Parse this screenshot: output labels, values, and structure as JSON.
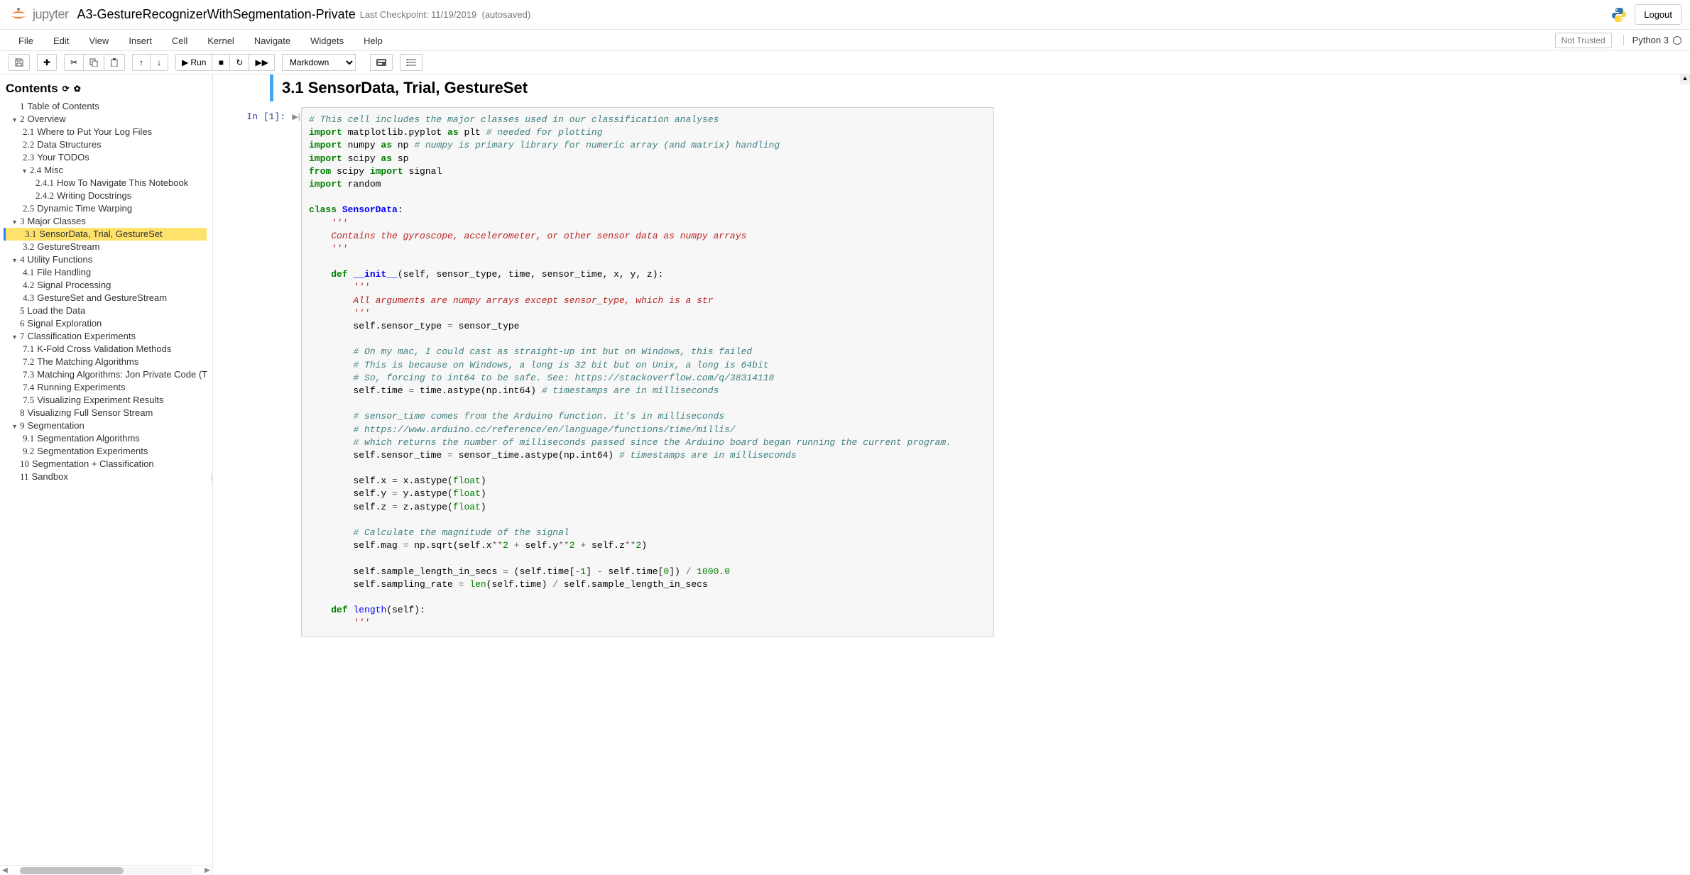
{
  "header": {
    "logo_text": "jupyter",
    "notebook_name": "A3-GestureRecognizerWithSegmentation-Private",
    "checkpoint": "Last Checkpoint: 11/19/2019",
    "autosaved": "(autosaved)",
    "logout": "Logout"
  },
  "menubar": {
    "items": [
      "File",
      "Edit",
      "View",
      "Insert",
      "Cell",
      "Kernel",
      "Navigate",
      "Widgets",
      "Help"
    ],
    "trust": "Not Trusted",
    "kernel": "Python 3"
  },
  "toolbar": {
    "run_label": "Run",
    "cell_type": "Markdown"
  },
  "toc": {
    "title": "Contents",
    "items": [
      {
        "level": 1,
        "num": "1",
        "label": "Table of Contents",
        "caret": ""
      },
      {
        "level": 1,
        "num": "2",
        "label": "Overview",
        "caret": "▾"
      },
      {
        "level": 2,
        "num": "2.1",
        "label": "Where to Put Your Log Files"
      },
      {
        "level": 2,
        "num": "2.2",
        "label": "Data Structures"
      },
      {
        "level": 2,
        "num": "2.3",
        "label": "Your TODOs"
      },
      {
        "level": 2,
        "num": "2.4",
        "label": "Misc",
        "caret": "▾"
      },
      {
        "level": 3,
        "num": "2.4.1",
        "label": "How To Navigate This Notebook"
      },
      {
        "level": 3,
        "num": "2.4.2",
        "label": "Writing Docstrings"
      },
      {
        "level": 2,
        "num": "2.5",
        "label": "Dynamic Time Warping"
      },
      {
        "level": 1,
        "num": "3",
        "label": "Major Classes",
        "caret": "▾"
      },
      {
        "level": 2,
        "num": "3.1",
        "label": "SensorData, Trial, GestureSet",
        "active": true
      },
      {
        "level": 2,
        "num": "3.2",
        "label": "GestureStream"
      },
      {
        "level": 1,
        "num": "4",
        "label": "Utility Functions",
        "caret": "▾"
      },
      {
        "level": 2,
        "num": "4.1",
        "label": "File Handling"
      },
      {
        "level": 2,
        "num": "4.2",
        "label": "Signal Processing"
      },
      {
        "level": 2,
        "num": "4.3",
        "label": "GestureSet and GestureStream"
      },
      {
        "level": 1,
        "num": "5",
        "label": "Load the Data"
      },
      {
        "level": 1,
        "num": "6",
        "label": "Signal Exploration"
      },
      {
        "level": 1,
        "num": "7",
        "label": "Classification Experiments",
        "caret": "▾"
      },
      {
        "level": 2,
        "num": "7.1",
        "label": "K-Fold Cross Validation Methods"
      },
      {
        "level": 2,
        "num": "7.2",
        "label": "The Matching Algorithms"
      },
      {
        "level": 2,
        "num": "7.3",
        "label": "Matching Algorithms: Jon Private Code (T"
      },
      {
        "level": 2,
        "num": "7.4",
        "label": "Running Experiments"
      },
      {
        "level": 2,
        "num": "7.5",
        "label": "Visualizing Experiment Results"
      },
      {
        "level": 1,
        "num": "8",
        "label": "Visualizing Full Sensor Stream"
      },
      {
        "level": 1,
        "num": "9",
        "label": "Segmentation",
        "caret": "▾"
      },
      {
        "level": 2,
        "num": "9.1",
        "label": "Segmentation Algorithms"
      },
      {
        "level": 2,
        "num": "9.2",
        "label": "Segmentation Experiments"
      },
      {
        "level": 1,
        "num": "10",
        "label": "Segmentation + Classification"
      },
      {
        "level": 1,
        "num": "11",
        "label": "Sandbox"
      }
    ]
  },
  "cells": {
    "heading": "3.1  SensorData, Trial, GestureSet",
    "prompt": "In [1]:",
    "code_lines": [
      {
        "t": [
          [
            "c",
            "# This cell includes the major classes used in our classification analyses"
          ]
        ]
      },
      {
        "t": [
          [
            "kn",
            "import"
          ],
          [
            "",
            " matplotlib.pyplot "
          ],
          [
            "kn",
            "as"
          ],
          [
            "",
            " plt "
          ],
          [
            "c",
            "# needed for plotting"
          ]
        ]
      },
      {
        "t": [
          [
            "kn",
            "import"
          ],
          [
            "",
            " numpy "
          ],
          [
            "kn",
            "as"
          ],
          [
            "",
            " np "
          ],
          [
            "c",
            "# numpy is primary library for numeric array (and matrix) handling"
          ]
        ]
      },
      {
        "t": [
          [
            "kn",
            "import"
          ],
          [
            "",
            " scipy "
          ],
          [
            "kn",
            "as"
          ],
          [
            "",
            " sp"
          ]
        ]
      },
      {
        "t": [
          [
            "kn",
            "from"
          ],
          [
            "",
            " scipy "
          ],
          [
            "kn",
            "import"
          ],
          [
            "",
            " signal"
          ]
        ]
      },
      {
        "t": [
          [
            "kn",
            "import"
          ],
          [
            "",
            " random"
          ]
        ]
      },
      {
        "t": [
          [
            "",
            ""
          ]
        ]
      },
      {
        "t": [
          [
            "k",
            "class"
          ],
          [
            "",
            " "
          ],
          [
            "nc",
            "SensorData"
          ],
          [
            "",
            ":"
          ]
        ]
      },
      {
        "t": [
          [
            "",
            "    "
          ],
          [
            "sd",
            "'''"
          ]
        ]
      },
      {
        "t": [
          [
            "",
            "    "
          ],
          [
            "sd",
            "Contains the gyroscope, accelerometer, or other sensor data as numpy arrays"
          ]
        ]
      },
      {
        "t": [
          [
            "",
            "    "
          ],
          [
            "sd",
            "'''"
          ]
        ]
      },
      {
        "t": [
          [
            "",
            ""
          ]
        ]
      },
      {
        "t": [
          [
            "",
            "    "
          ],
          [
            "k",
            "def"
          ],
          [
            "",
            " "
          ],
          [
            "nd",
            "__init__"
          ],
          [
            "",
            "(self, sensor_type, time, sensor_time, x, y, z):"
          ]
        ]
      },
      {
        "t": [
          [
            "",
            "        "
          ],
          [
            "sd",
            "'''"
          ]
        ]
      },
      {
        "t": [
          [
            "",
            "        "
          ],
          [
            "sd",
            "All arguments are numpy arrays except sensor_type, which is a str"
          ]
        ]
      },
      {
        "t": [
          [
            "",
            "        "
          ],
          [
            "sd",
            "'''"
          ]
        ]
      },
      {
        "t": [
          [
            "",
            "        self.sensor_type "
          ],
          [
            "o",
            "="
          ],
          [
            "",
            " sensor_type"
          ]
        ]
      },
      {
        "t": [
          [
            "",
            ""
          ]
        ]
      },
      {
        "t": [
          [
            "",
            "        "
          ],
          [
            "c",
            "# On my mac, I could cast as straight-up int but on Windows, this failed"
          ]
        ]
      },
      {
        "t": [
          [
            "",
            "        "
          ],
          [
            "c",
            "# This is because on Windows, a long is 32 bit but on Unix, a long is 64bit"
          ]
        ]
      },
      {
        "t": [
          [
            "",
            "        "
          ],
          [
            "c",
            "# So, forcing to int64 to be safe. See: https://stackoverflow.com/q/38314118"
          ]
        ]
      },
      {
        "t": [
          [
            "",
            "        self.time "
          ],
          [
            "o",
            "="
          ],
          [
            "",
            " time.astype(np.int64) "
          ],
          [
            "c",
            "# timestamps are in milliseconds"
          ]
        ]
      },
      {
        "t": [
          [
            "",
            ""
          ]
        ]
      },
      {
        "t": [
          [
            "",
            "        "
          ],
          [
            "c",
            "# sensor_time comes from the Arduino function. it's in milliseconds"
          ]
        ]
      },
      {
        "t": [
          [
            "",
            "        "
          ],
          [
            "c",
            "# https://www.arduino.cc/reference/en/language/functions/time/millis/"
          ]
        ]
      },
      {
        "t": [
          [
            "",
            "        "
          ],
          [
            "c",
            "# which returns the number of milliseconds passed since the Arduino board began running the current program."
          ]
        ]
      },
      {
        "t": [
          [
            "",
            "        self.sensor_time "
          ],
          [
            "o",
            "="
          ],
          [
            "",
            " sensor_time.astype(np.int64) "
          ],
          [
            "c",
            "# timestamps are in milliseconds"
          ]
        ]
      },
      {
        "t": [
          [
            "",
            ""
          ]
        ]
      },
      {
        "t": [
          [
            "",
            "        self.x "
          ],
          [
            "o",
            "="
          ],
          [
            "",
            " x.astype("
          ],
          [
            "nb",
            "float"
          ],
          [
            "",
            ")"
          ]
        ]
      },
      {
        "t": [
          [
            "",
            "        self.y "
          ],
          [
            "o",
            "="
          ],
          [
            "",
            " y.astype("
          ],
          [
            "nb",
            "float"
          ],
          [
            "",
            ")"
          ]
        ]
      },
      {
        "t": [
          [
            "",
            "        self.z "
          ],
          [
            "o",
            "="
          ],
          [
            "",
            " z.astype("
          ],
          [
            "nb",
            "float"
          ],
          [
            "",
            ")"
          ]
        ]
      },
      {
        "t": [
          [
            "",
            ""
          ]
        ]
      },
      {
        "t": [
          [
            "",
            "        "
          ],
          [
            "c",
            "# Calculate the magnitude of the signal"
          ]
        ]
      },
      {
        "t": [
          [
            "",
            "        self.mag "
          ],
          [
            "o",
            "="
          ],
          [
            "",
            " np.sqrt(self.x"
          ],
          [
            "o",
            "**"
          ],
          [
            "m",
            "2"
          ],
          [
            "",
            " "
          ],
          [
            "o",
            "+"
          ],
          [
            "",
            " self.y"
          ],
          [
            "o",
            "**"
          ],
          [
            "m",
            "2"
          ],
          [
            "",
            " "
          ],
          [
            "o",
            "+"
          ],
          [
            "",
            " self.z"
          ],
          [
            "o",
            "**"
          ],
          [
            "m",
            "2"
          ],
          [
            "",
            ")"
          ]
        ]
      },
      {
        "t": [
          [
            "",
            ""
          ]
        ]
      },
      {
        "t": [
          [
            "",
            "        self.sample_length_in_secs "
          ],
          [
            "o",
            "="
          ],
          [
            "",
            " (self.time["
          ],
          [
            "o",
            "-"
          ],
          [
            "m",
            "1"
          ],
          [
            "",
            "] "
          ],
          [
            "o",
            "-"
          ],
          [
            "",
            " self.time["
          ],
          [
            "m",
            "0"
          ],
          [
            "",
            "]) "
          ],
          [
            "o",
            "/"
          ],
          [
            "",
            " "
          ],
          [
            "m",
            "1000.0"
          ]
        ]
      },
      {
        "t": [
          [
            "",
            "        self.sampling_rate "
          ],
          [
            "o",
            "="
          ],
          [
            "",
            " "
          ],
          [
            "nb",
            "len"
          ],
          [
            "",
            "(self.time) "
          ],
          [
            "o",
            "/"
          ],
          [
            "",
            " self.sample_length_in_secs"
          ]
        ]
      },
      {
        "t": [
          [
            "",
            ""
          ]
        ]
      },
      {
        "t": [
          [
            "",
            "    "
          ],
          [
            "k",
            "def"
          ],
          [
            "",
            " "
          ],
          [
            "nf",
            "length"
          ],
          [
            "",
            "(self):"
          ]
        ]
      },
      {
        "t": [
          [
            "",
            "        "
          ],
          [
            "sd",
            "'''"
          ]
        ]
      }
    ]
  }
}
